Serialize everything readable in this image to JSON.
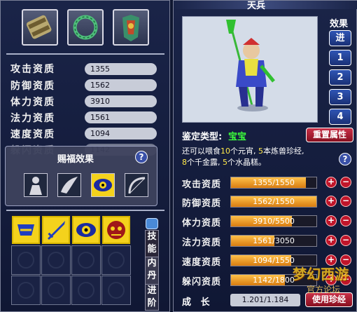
{
  "left": {
    "equipment": [
      {
        "icon": "scroll-icon"
      },
      {
        "icon": "jade-ring-icon"
      },
      {
        "icon": "armor-icon"
      }
    ],
    "stats": [
      {
        "label": "攻击资质",
        "value": "1355"
      },
      {
        "label": "防御资质",
        "value": "1562"
      },
      {
        "label": "体力资质",
        "value": "3910"
      },
      {
        "label": "法力资质",
        "value": "1561"
      },
      {
        "label": "速度资质",
        "value": "1094"
      },
      {
        "label": "躲闪资质",
        "value": "1142"
      }
    ],
    "popup": {
      "title": "赐福效果",
      "help": "?",
      "skills": [
        {
          "icon": "figure-skill-icon"
        },
        {
          "icon": "wing-skill-icon"
        },
        {
          "icon": "eye-skill-icon"
        },
        {
          "icon": "bow-skill-icon"
        }
      ]
    },
    "side_buttons": {
      "skill": "技能",
      "inner_dan": "内丹",
      "advance": "进阶"
    },
    "skill_slots": [
      {
        "icon": "blue-scarf-skill-icon"
      },
      {
        "icon": "sword-skill-icon"
      },
      {
        "icon": "eye-skill-icon"
      },
      {
        "icon": "demon-skill-icon"
      }
    ]
  },
  "right": {
    "title": "天兵",
    "effect_label": "效果",
    "buttons": [
      "进",
      "1",
      "2",
      "3",
      "4"
    ],
    "identify_label": "鉴定类型:",
    "identify_value": "宝宝",
    "reset_button": "重置属性",
    "feed_text": {
      "p1": "还可以喂食",
      "n1": "10",
      "p2": "个元宵, ",
      "n2": "5",
      "p3": "本炼兽珍经,",
      "n3": "8",
      "p4": "个千金露, ",
      "n4": "5",
      "p5": "个水晶糕。"
    },
    "help": "?",
    "aptitudes": [
      {
        "label": "攻击资质",
        "text": "1355/1550",
        "value": 1355,
        "max": 1550
      },
      {
        "label": "防御资质",
        "text": "1562/1550",
        "value": 1562,
        "max": 1550
      },
      {
        "label": "体力资质",
        "text": "3910/5500",
        "value": 3910,
        "max": 5500
      },
      {
        "label": "法力资质",
        "text": "1561/3050",
        "value": 1561,
        "max": 3050
      },
      {
        "label": "速度资质",
        "text": "1094/1550",
        "value": 1094,
        "max": 1550
      },
      {
        "label": "躲闪资质",
        "text": "1142/1800",
        "value": 1142,
        "max": 1800
      }
    ],
    "growth_label": "成   长",
    "growth_value": "1.201/1.184",
    "use_button": "使用珍经",
    "watermark": "梦幻西游",
    "watermark_sub": "官方论坛"
  },
  "colors": {
    "highlight": "#ffe94a",
    "value_green": "#3cff3c",
    "bar_orange": "#f0a020",
    "plus_minus_red": "#c0152a"
  }
}
